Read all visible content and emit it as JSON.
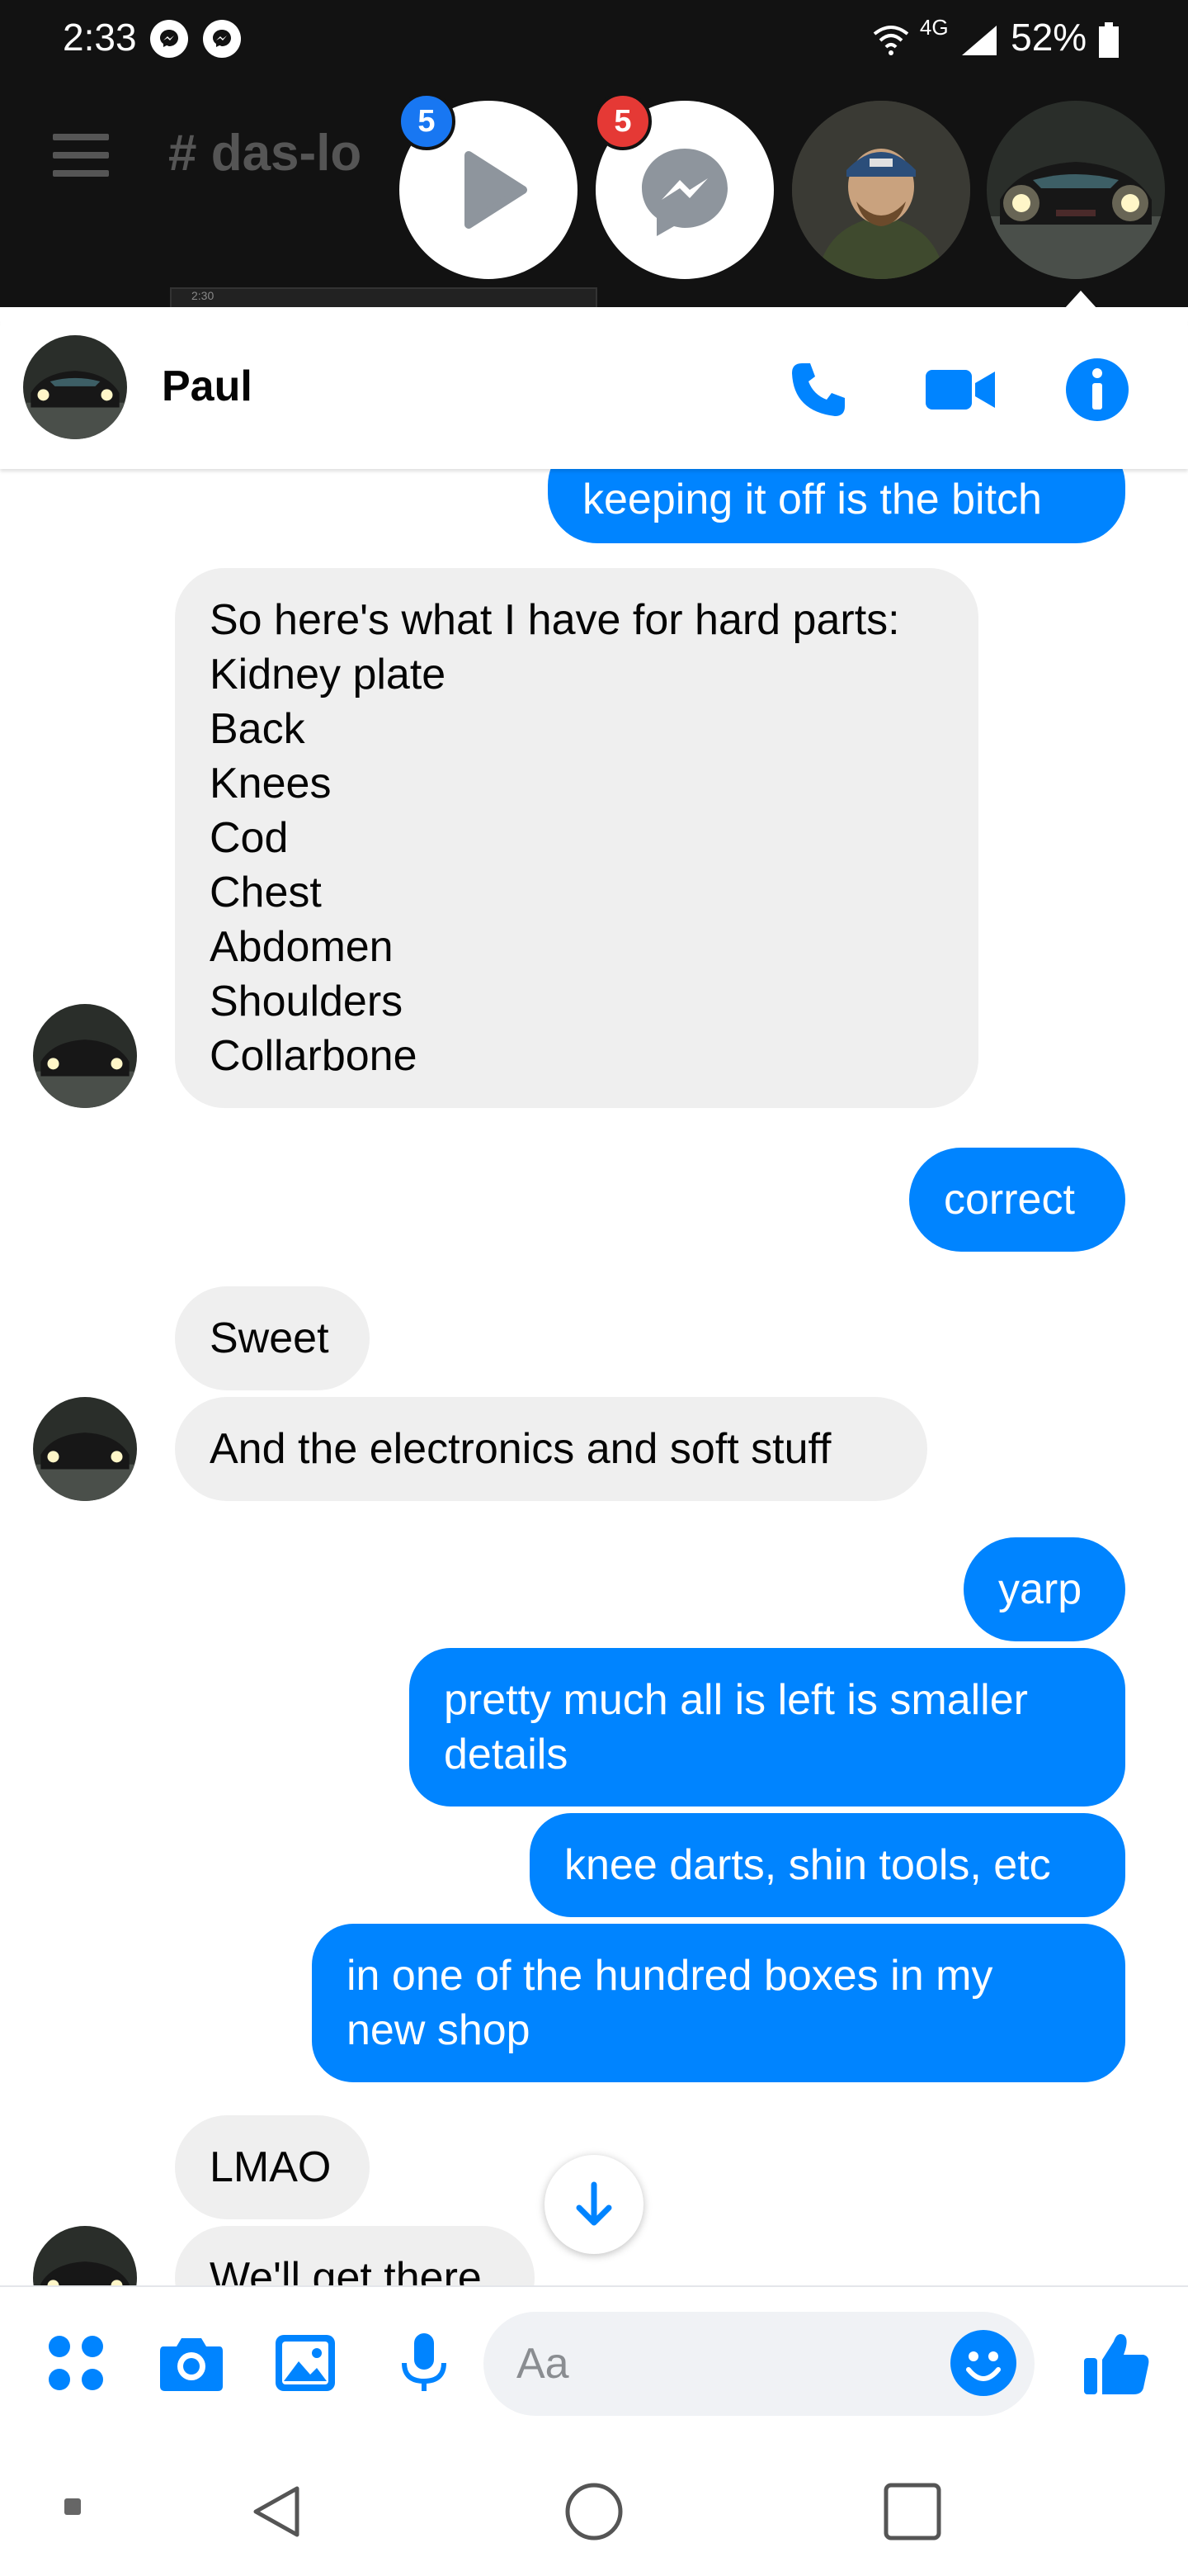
{
  "status_bar": {
    "time": "2:33",
    "network": "4G",
    "battery": "52%"
  },
  "background_app": {
    "channel": "# das-lo",
    "screenshot_time": "2:30"
  },
  "chat_heads": [
    {
      "name": "video-chat-head",
      "badge": "5"
    },
    {
      "name": "messenger-chat-head",
      "badge": "5"
    }
  ],
  "header": {
    "contact_name": "Paul"
  },
  "messages": [
    {
      "id": "m0",
      "side": "out",
      "text": "keeping it off is the bitch"
    },
    {
      "id": "m1",
      "side": "in",
      "text": "So here's what I have for hard parts:\nKidney plate\nBack\nKnees\nCod\nChest\nAbdomen\nShoulders\nCollarbone"
    },
    {
      "id": "m2",
      "side": "out",
      "text": "correct"
    },
    {
      "id": "m3",
      "side": "in",
      "text": "Sweet"
    },
    {
      "id": "m4",
      "side": "in",
      "text": "And the electronics and soft stuff"
    },
    {
      "id": "m5",
      "side": "out",
      "text": "yarp"
    },
    {
      "id": "m6",
      "side": "out",
      "text": "pretty much all is left is smaller\ndetails"
    },
    {
      "id": "m7",
      "side": "out",
      "text": "knee darts, shin tools, etc"
    },
    {
      "id": "m8",
      "side": "out",
      "text": "in one of the hundred boxes in my\nnew shop"
    },
    {
      "id": "m9",
      "side": "in",
      "text": "LMAO"
    },
    {
      "id": "m10",
      "side": "in",
      "text": "We'll get there"
    }
  ],
  "composer": {
    "placeholder": "Aa"
  },
  "colors": {
    "accent": "#0084ff",
    "incoming": "#efefef",
    "badge_blue": "#1877f2",
    "badge_red": "#e53935"
  }
}
